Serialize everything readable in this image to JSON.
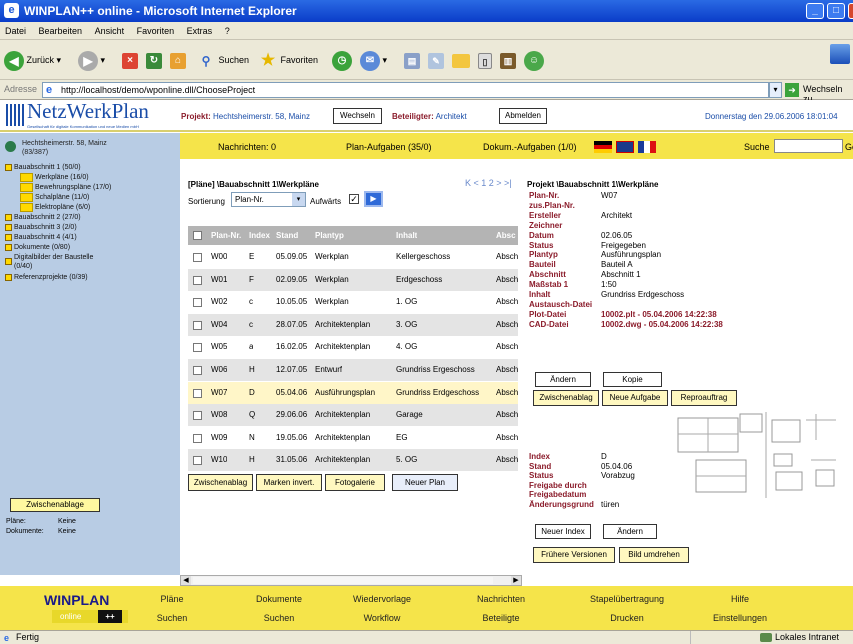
{
  "window": {
    "title": "WINPLAN++ online - Microsoft Internet Explorer"
  },
  "menu": [
    "Datei",
    "Bearbeiten",
    "Ansicht",
    "Favoriten",
    "Extras",
    "?"
  ],
  "toolbar": {
    "back": "Zurück",
    "search": "Suchen",
    "favorites": "Favoriten"
  },
  "address": {
    "label": "Adresse",
    "url": "http://localhost/demo/wponline.dll/ChooseProject",
    "go": "Wechseln zu"
  },
  "header": {
    "logo": "NetzWerkPlan",
    "logo_sub": "Gesellschaft für digitale Kommunikation und neue Medien mbH",
    "projekt_label": "Projekt:",
    "projekt_value": "Hechtsheimerstr. 58, Mainz",
    "wechseln": "Wechseln",
    "beteiligter_label": "Beteiligter:",
    "beteiligter_value": "Architekt",
    "abmelden": "Abmelden",
    "date": "Donnerstag den 29.06.2006 18:01:04"
  },
  "yellowbar": {
    "nachrichten": "Nachrichten: 0",
    "plan_aufgaben": "Plan-Aufgaben (35/0)",
    "dokum": "Dokum.-Aufgaben (1/0)",
    "suche": "Suche",
    "go": "Go"
  },
  "tree": {
    "root_line1": "Hechtsheimerstr. 58, Mainz",
    "root_line2": "(83/387)",
    "items": [
      {
        "label": "Bauabschnitt 1 (50/0)",
        "level": 0
      },
      {
        "label": "Werkpläne (16/0)",
        "level": 1
      },
      {
        "label": "Bewehrungspläne (17/0)",
        "level": 1
      },
      {
        "label": "Schalpläne (11/0)",
        "level": 1
      },
      {
        "label": "Elektropläne (6/0)",
        "level": 1
      },
      {
        "label": "Bauabschnitt 2 (27/0)",
        "level": 0
      },
      {
        "label": "Bauabschnitt 3 (2/0)",
        "level": 0
      },
      {
        "label": "Bauabschnitt 4 (4/1)",
        "level": 0
      },
      {
        "label": "Dokumente (0/80)",
        "level": 0
      },
      {
        "label": "Digitalbilder der Baustelle",
        "label2": "(0/40)",
        "level": 0
      },
      {
        "label": "Referenzprojekte (0/39)",
        "level": 0
      }
    ],
    "zwischenablage": "Zwischenablage",
    "plaene_label": "Pläne:",
    "plaene_value": "Keine",
    "dokumente_label": "Dokumente:",
    "dokumente_value": "Keine"
  },
  "list": {
    "heading": "[Pläne] \\Bauabschnitt 1\\Werkpläne",
    "pager": "K < 1 2 > >|",
    "sort_label": "Sortierung",
    "sort_value": "Plan-Nr.",
    "aufwaerts": "Aufwärts",
    "columns": [
      "Plan-Nr.",
      "Index",
      "Stand",
      "Plantyp",
      "Inhalt",
      "Absc"
    ],
    "rows": [
      {
        "nr": "W00",
        "index": "E",
        "stand": "05.09.05",
        "typ": "Werkplan",
        "inhalt": "Kellergeschoss",
        "absc": "Absch"
      },
      {
        "nr": "W01",
        "index": "F",
        "stand": "02.09.05",
        "typ": "Werkplan",
        "inhalt": "Erdgeschoss",
        "absc": "Absch"
      },
      {
        "nr": "W02",
        "index": "c",
        "stand": "10.05.05",
        "typ": "Werkplan",
        "inhalt": "1. OG",
        "absc": "Absch"
      },
      {
        "nr": "W04",
        "index": "c",
        "stand": "28.07.05",
        "typ": "Architektenplan",
        "inhalt": "3. OG",
        "absc": "Absch"
      },
      {
        "nr": "W05",
        "index": "a",
        "stand": "16.02.05",
        "typ": "Architektenplan",
        "inhalt": "4. OG",
        "absc": "Absch"
      },
      {
        "nr": "W06",
        "index": "H",
        "stand": "12.07.05",
        "typ": "Entwurf",
        "inhalt": "Grundriss Ergeschoss",
        "absc": "Absch"
      },
      {
        "nr": "W07",
        "index": "D",
        "stand": "05.04.06",
        "typ": "Ausführungsplan",
        "inhalt": "Grundriss Erdgeschoss",
        "absc": "Absch"
      },
      {
        "nr": "W08",
        "index": "Q",
        "stand": "29.06.06",
        "typ": "Architektenplan",
        "inhalt": "Garage",
        "absc": "Absch"
      },
      {
        "nr": "W09",
        "index": "N",
        "stand": "19.05.06",
        "typ": "Architektenplan",
        "inhalt": "EG",
        "absc": "Absch"
      },
      {
        "nr": "W10",
        "index": "H",
        "stand": "31.05.06",
        "typ": "Architektenplan",
        "inhalt": "5. OG",
        "absc": "Absch"
      }
    ],
    "buttons": {
      "zwischenablage": "Zwischenablag",
      "marken": "Marken invert.",
      "foto": "Fotogalerie",
      "neuer": "Neuer Plan"
    }
  },
  "detail": {
    "heading": "Projekt \\Bauabschnitt 1\\Werkpläne",
    "fields": [
      {
        "label": "Plan-Nr.",
        "value": "W07"
      },
      {
        "label": "zus.Plan-Nr.",
        "value": ""
      },
      {
        "label": "Ersteller",
        "value": "Architekt"
      },
      {
        "label": "Zeichner",
        "value": ""
      },
      {
        "label": "Datum",
        "value": "02.06.05"
      },
      {
        "label": "Status",
        "value": "Freigegeben"
      },
      {
        "label": "Plantyp",
        "value": "Ausführungsplan"
      },
      {
        "label": "Bauteil",
        "value": "Bauteil A"
      },
      {
        "label": "Abschnitt",
        "value": "Abschnitt 1"
      },
      {
        "label": "Maßstab 1",
        "value": "1:50"
      },
      {
        "label": "Inhalt",
        "value": "Grundriss Erdgeschoss"
      },
      {
        "label": "Austausch-Datei",
        "value": ""
      },
      {
        "label": "Plot-Datei",
        "value": "10002.plt - 05.04.2006 14:22:38"
      },
      {
        "label": "CAD-Datei",
        "value": "10002.dwg - 05.04.2006 14:22:38"
      }
    ],
    "btn_aendern": "Ändern",
    "btn_kopie": "Kopie",
    "btn_zwischen": "Zwischenablag",
    "btn_neue_aufgabe": "Neue Aufgabe",
    "btn_repro": "Reproauftrag",
    "index_fields": [
      {
        "label": "Index",
        "value": "D"
      },
      {
        "label": "Stand",
        "value": "05.04.06"
      },
      {
        "label": "Status",
        "value": "Vorabzug"
      },
      {
        "label": "Freigabe durch",
        "value": ""
      },
      {
        "label": "Freigabedatum",
        "value": ""
      },
      {
        "label": "Änderungsgrund",
        "value": "türen"
      }
    ],
    "btn_neuer_index": "Neuer Index",
    "btn_aendern2": "Ändern",
    "btn_fruehere": "Frühere Versionen",
    "btn_bild": "Bild umdrehen"
  },
  "footer": {
    "brand": "WINPLAN",
    "brand_sub": "online",
    "row1": [
      "Pläne",
      "Dokumente",
      "Wiedervorlage",
      "Nachrichten",
      "Stapelübertragung",
      "Hilfe"
    ],
    "row2": [
      "Suchen",
      "Suchen",
      "Workflow",
      "Beteiligte",
      "Drucken",
      "Einstellungen"
    ]
  },
  "status": {
    "left": "Fertig",
    "right": "Lokales Intranet"
  }
}
